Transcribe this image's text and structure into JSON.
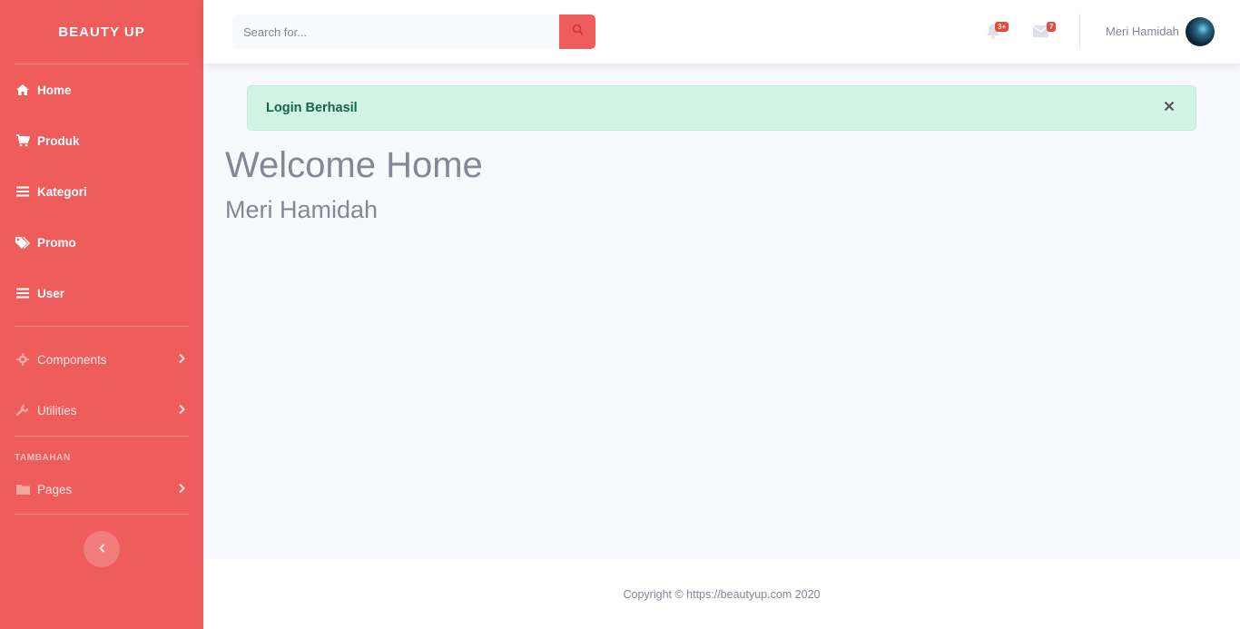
{
  "brand": "BEAUTY UP",
  "sidebar": {
    "main_items": [
      {
        "label": "Home",
        "icon": "home-icon"
      },
      {
        "label": "Produk",
        "icon": "cart-icon"
      },
      {
        "label": "Kategori",
        "icon": "list-icon"
      },
      {
        "label": "Promo",
        "icon": "tags-icon"
      },
      {
        "label": "User",
        "icon": "list-icon"
      }
    ],
    "secondary_items": [
      {
        "label": "Components",
        "icon": "gear-icon"
      },
      {
        "label": "Utilities",
        "icon": "wrench-icon"
      }
    ],
    "heading": "TAMBAHAN",
    "extra_items": [
      {
        "label": "Pages",
        "icon": "folder-icon"
      }
    ]
  },
  "topbar": {
    "search_placeholder": "Search for...",
    "alerts_badge": "3+",
    "messages_badge": "7",
    "username": "Meri Hamidah"
  },
  "alert": {
    "message": "Login Berhasil"
  },
  "main": {
    "title": "Welcome Home",
    "subtitle": "Meri Hamidah"
  },
  "footer": {
    "copyright": "Copyright © https://beautyup.com 2020"
  },
  "colors": {
    "accent": "#ee5c5c",
    "alert_bg": "#d4f3e7",
    "alert_text": "#14664a",
    "badge": "#e74a3b"
  }
}
